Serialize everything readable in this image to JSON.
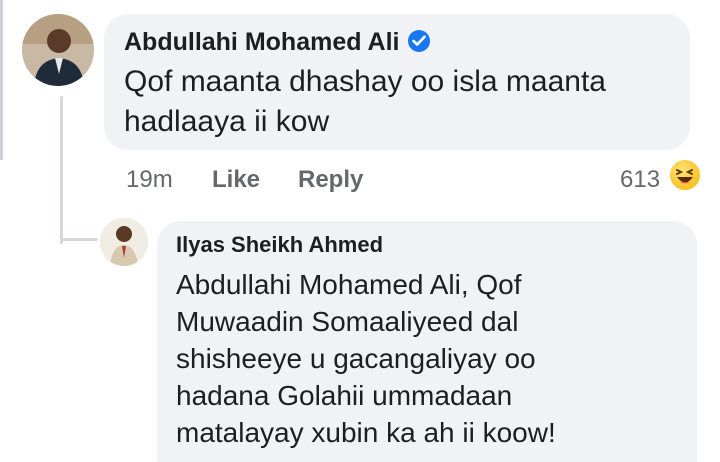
{
  "comment": {
    "author": "Abdullahi Mohamed Ali",
    "verified": true,
    "text": "Qof maanta dhashay oo isla maanta\nhadlaaya ii kow",
    "time": "19m",
    "like_label": "Like",
    "reply_label": "Reply",
    "reaction_count": "613",
    "reaction_icon": "laughing-emoji-icon"
  },
  "reply": {
    "author": "Ilyas Sheikh Ahmed",
    "text": "Abdullahi Mohamed Ali, Qof\nMuwaadin Somaaliyeed dal\nshisheeye u gacangaliyay oo\nhadana Golahii ummadaan\nmatalayay xubin ka ah ii koow!"
  },
  "colors": {
    "bubble": "#f0f2f5",
    "verified_badge": "#1877f2",
    "meta_text": "#65676b",
    "primary_text": "#1c1e21"
  }
}
